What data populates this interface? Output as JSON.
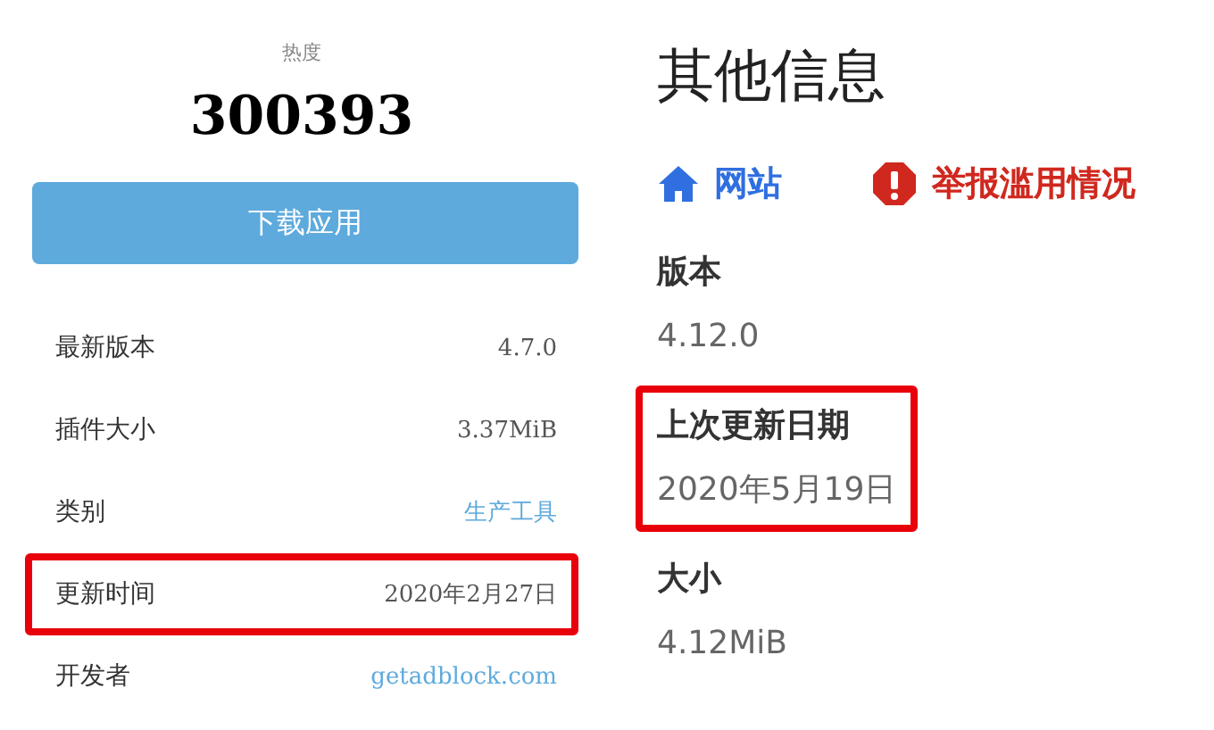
{
  "app_panel": {
    "popularity": {
      "label": "热度",
      "value": "300393"
    },
    "download_button": "下载应用",
    "info_rows": [
      {
        "label": "最新版本",
        "value": "4.7.0",
        "kind": "text",
        "highlighted": false
      },
      {
        "label": "插件大小",
        "value": "3.37MiB",
        "kind": "text",
        "highlighted": false
      },
      {
        "label": "类别",
        "value": "生产工具",
        "kind": "link",
        "highlighted": false
      },
      {
        "label": "更新时间",
        "value": "2020年2月27日",
        "kind": "text",
        "highlighted": true
      },
      {
        "label": "开发者",
        "value": "getadblock.com",
        "kind": "link",
        "highlighted": false
      }
    ]
  },
  "other_info": {
    "title": "其他信息",
    "links": [
      {
        "kind": "website",
        "label": "网站"
      },
      {
        "kind": "report",
        "label": "举报滥用情况"
      }
    ],
    "details": [
      {
        "label": "版本",
        "value": "4.12.0",
        "highlighted": false
      },
      {
        "label": "上次更新日期",
        "value": "2020年5月19日",
        "highlighted": true
      },
      {
        "label": "大小",
        "value": "4.12MiB",
        "highlighted": false
      }
    ]
  }
}
